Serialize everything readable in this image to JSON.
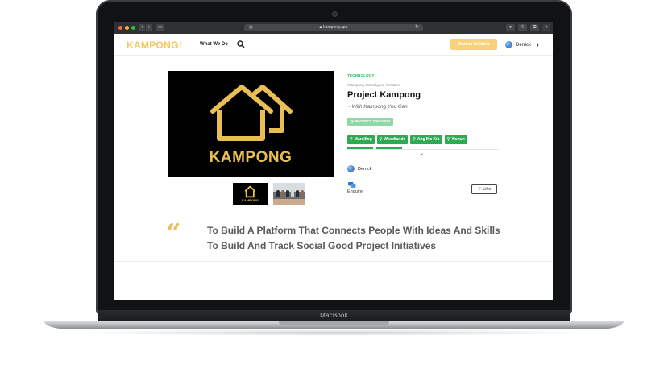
{
  "device": {
    "label": "MacBook"
  },
  "browser": {
    "address": "kampong.app"
  },
  "nav": {
    "logo": "KAMPONG!",
    "what_we_do": "What We Do",
    "start_initiative": "Start an Initiative",
    "user_name": "Derrick"
  },
  "project": {
    "category": "TECHNOLOGY",
    "hashtags": "#kampong  #socialgood  #initiative",
    "title": "Project Kampong",
    "subtitle": "~ With Kampong You Can",
    "status": "PROJECT ONGOING",
    "locations": [
      "Marsiling",
      "Woodlands",
      "Ang Mo Kio",
      "Yishun"
    ],
    "owner": "Derrick",
    "enquire_label": "Enquire",
    "like_label": "Like",
    "hero_word": "KAMPONG",
    "thumb_word": "KAMPONG"
  },
  "quote": {
    "mark": "“",
    "text": "To Build A Platform That Connects People With Ideas And Skills To Build And Track Social Good Project Initiatives"
  },
  "colors": {
    "brand_yellow": "#f5c65a",
    "green": "#2eaa55",
    "status_green": "#8fd7a9"
  }
}
